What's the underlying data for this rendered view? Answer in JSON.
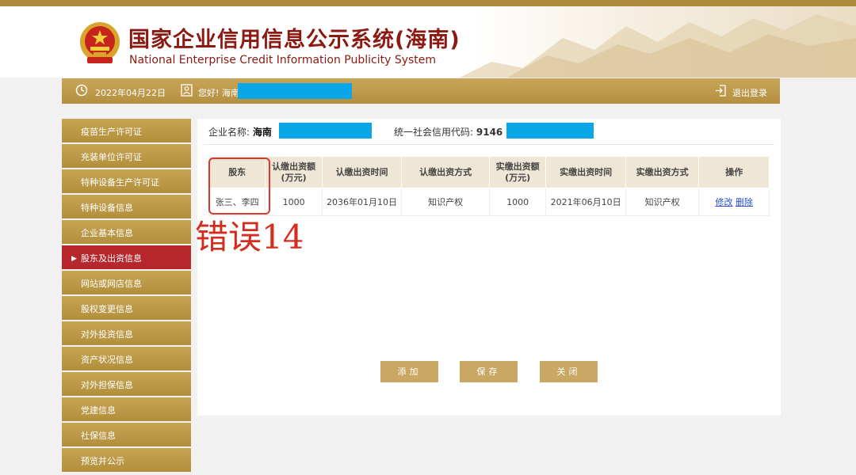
{
  "header": {
    "title_cn": "国家企业信用信息公示系统(海南)",
    "title_en": "National Enterprise Credit Information Publicity System"
  },
  "info_bar": {
    "date": "2022年04月22日",
    "greeting": "您好! 海南",
    "logout_label": "退出登录"
  },
  "sidebar": {
    "items": [
      {
        "label": "疫苗生产许可证"
      },
      {
        "label": "充装单位许可证"
      },
      {
        "label": "特种设备生产许可证"
      },
      {
        "label": "特种设备信息"
      },
      {
        "label": "企业基本信息"
      },
      {
        "label": "股东及出资信息",
        "active": true
      },
      {
        "label": "网站或网店信息"
      },
      {
        "label": "股权变更信息"
      },
      {
        "label": "对外投资信息"
      },
      {
        "label": "资产状况信息"
      },
      {
        "label": "对外担保信息"
      },
      {
        "label": "党建信息"
      },
      {
        "label": "社保信息"
      },
      {
        "label": "预览并公示"
      }
    ]
  },
  "company": {
    "name_label": "企业名称:",
    "name_value": "海南",
    "code_label": "统一社会信用代码:",
    "code_value": "9146"
  },
  "table": {
    "headers": [
      "股东",
      "认缴出资额(万元)",
      "认缴出资时间",
      "认缴出资方式",
      "实缴出资额(万元)",
      "实缴出资时间",
      "实缴出资方式",
      "操作"
    ],
    "rows": [
      {
        "shareholder": "张三、李四",
        "subscribed_amount": "1000",
        "subscribed_date": "2036年01月10日",
        "subscribed_method": "知识产权",
        "paid_amount": "1000",
        "paid_date": "2021年06月10日",
        "paid_method": "知识产权",
        "edit_label": "修改",
        "delete_label": "删除"
      }
    ]
  },
  "annotation": {
    "error_label": "错误14"
  },
  "buttons": {
    "add": "添加",
    "save": "保存",
    "close": "关闭"
  },
  "colors": {
    "gold": "#b8933f",
    "active_red": "#b6262b",
    "title_red": "#8b1a12",
    "mask_blue": "#0aa7e8",
    "annotation_red": "#d83a2e"
  }
}
